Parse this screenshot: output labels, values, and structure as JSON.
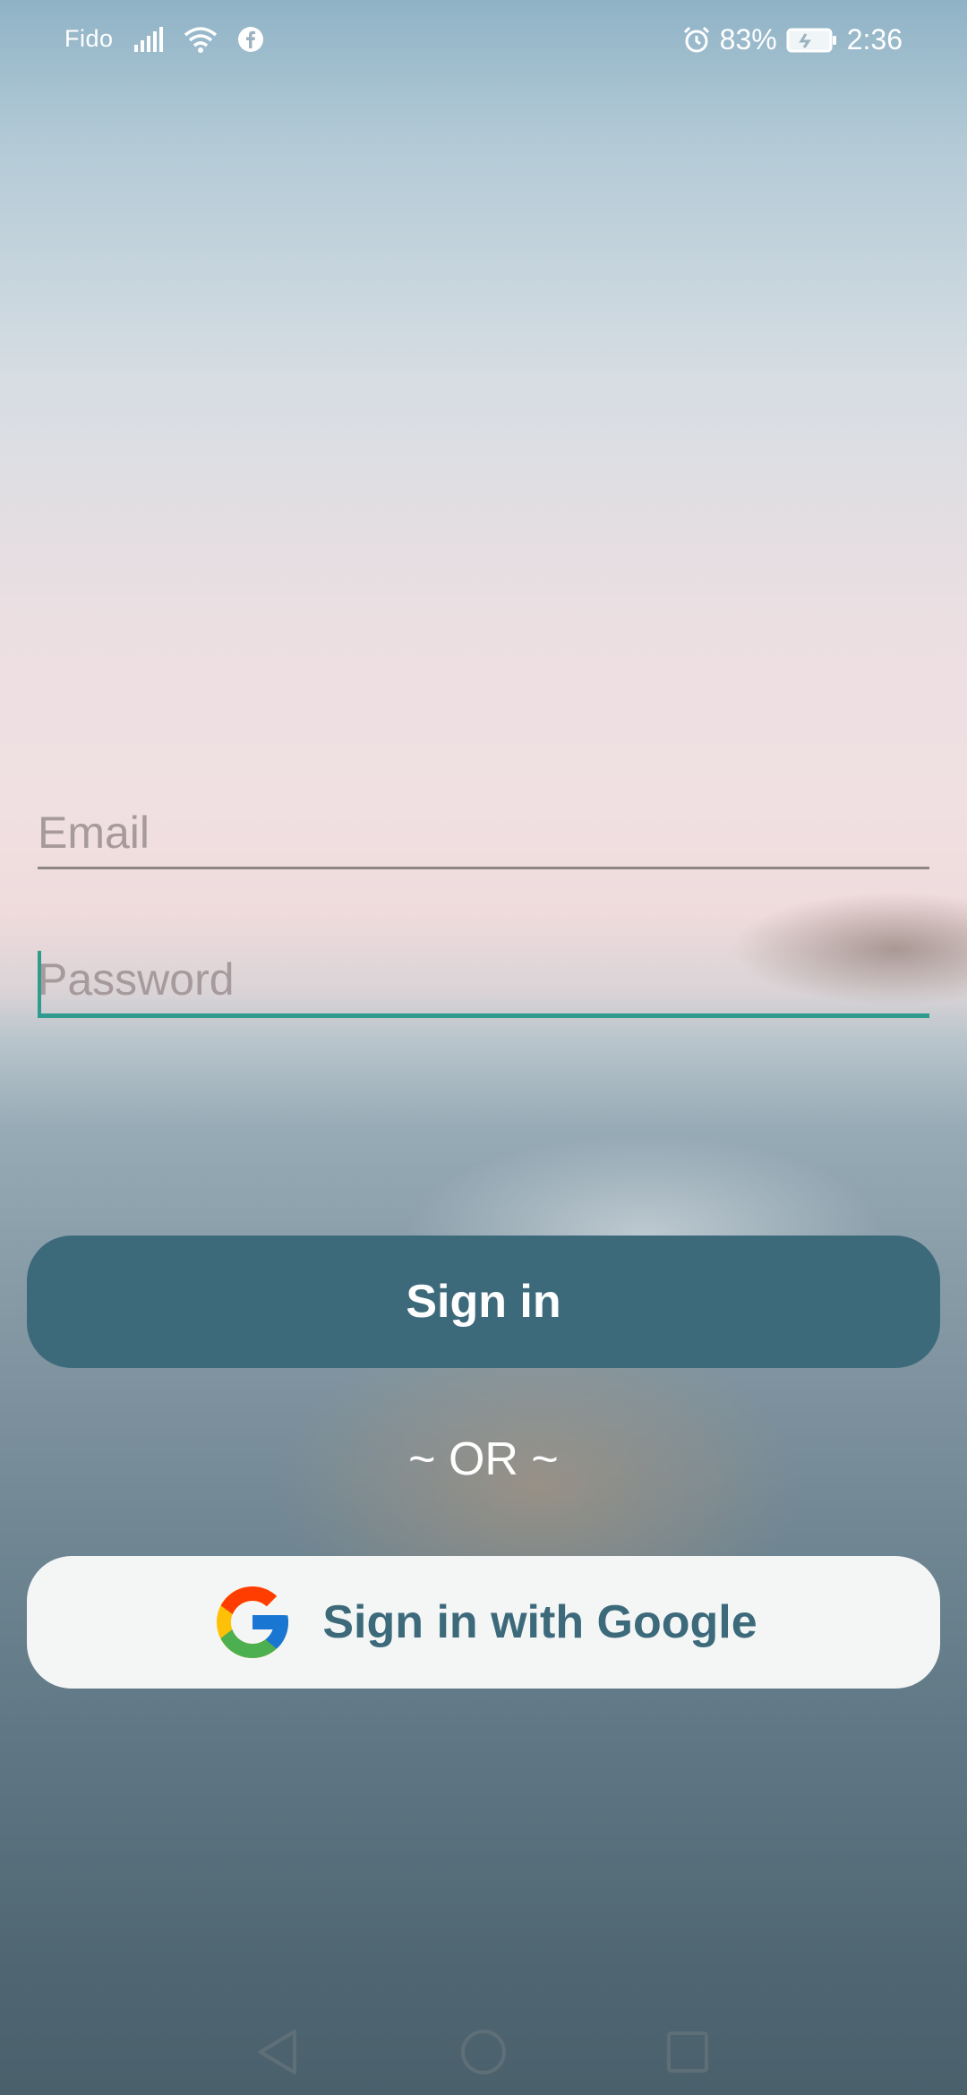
{
  "status_bar": {
    "carrier": "Fido",
    "battery": "83%",
    "time": "2:36",
    "icons": [
      "signal-icon",
      "wifi-icon",
      "facebook-icon",
      "alarm-icon",
      "battery-charging-icon"
    ]
  },
  "form": {
    "email_placeholder": "Email",
    "email_value": "",
    "password_placeholder": "Password",
    "password_value": ""
  },
  "buttons": {
    "signin_label": "Sign in",
    "or_text": "~ OR ~",
    "google_label": "Sign in with Google"
  },
  "colors": {
    "primary": "#3d6a7b",
    "accent": "#2f9a8e",
    "google_button_bg": "#f4f6f6"
  },
  "nav_bar": {
    "icons": [
      "back-icon",
      "home-icon",
      "recents-icon"
    ]
  }
}
